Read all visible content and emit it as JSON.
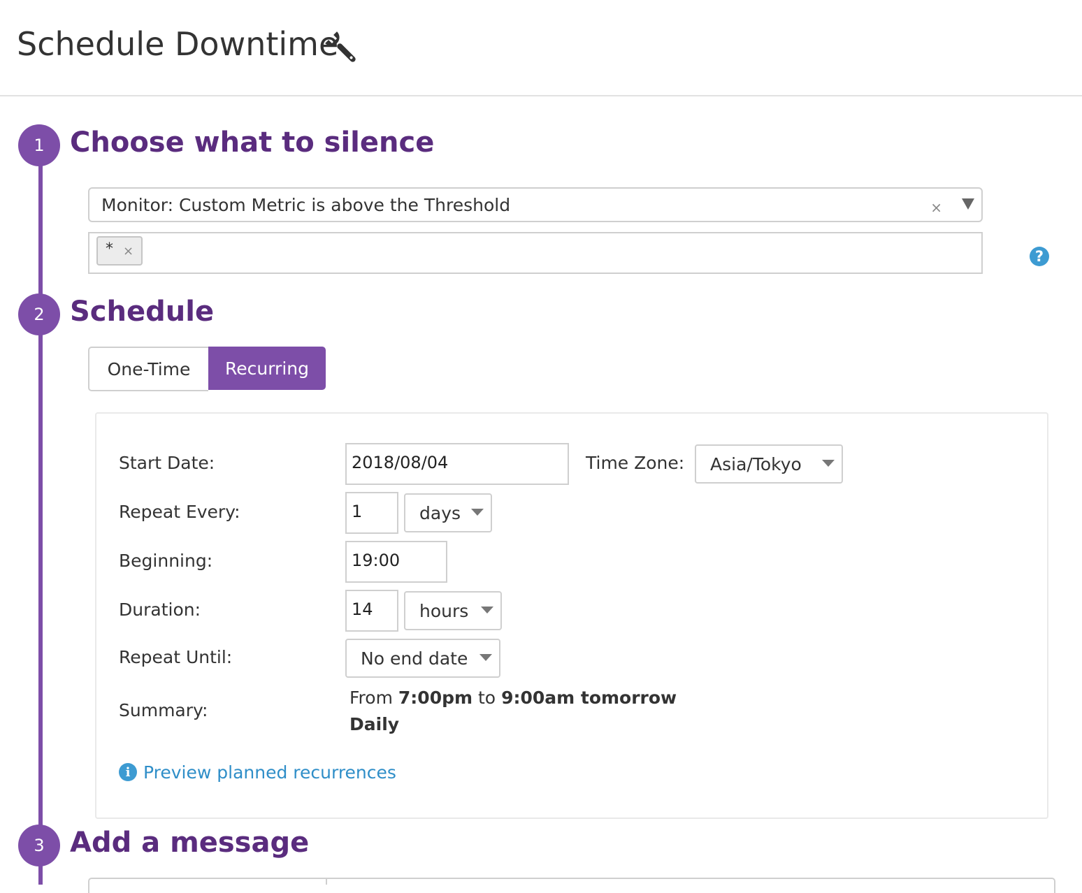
{
  "header": {
    "title": "Schedule Downtime",
    "icon": "wrench-icon"
  },
  "colors": {
    "accent": "#7d4ea8",
    "heading": "#5a2c7e",
    "link": "#2f8ec8",
    "help": "#3d9bd2"
  },
  "steps": [
    {
      "number": "1",
      "title": "Choose what to silence"
    },
    {
      "number": "2",
      "title": "Schedule"
    },
    {
      "number": "3",
      "title": "Add a message"
    }
  ],
  "silence": {
    "monitor_value": "Monitor: Custom Metric is above the Threshold",
    "clear_glyph": "×",
    "tag": "*",
    "tag_remove": "×",
    "help_glyph": "?"
  },
  "schedule": {
    "tabs": {
      "one_time": "One-Time",
      "recurring": "Recurring",
      "active": "recurring"
    },
    "form": {
      "start_date_label": "Start Date:",
      "start_date_value": "2018/08/04",
      "time_zone_label": "Time Zone:",
      "time_zone_value": "Asia/Tokyo",
      "repeat_every_label": "Repeat Every:",
      "repeat_every_value": "1",
      "repeat_every_unit": "days",
      "beginning_label": "Beginning:",
      "beginning_value": "19:00",
      "duration_label": "Duration:",
      "duration_value": "14",
      "duration_unit": "hours",
      "repeat_until_label": "Repeat Until:",
      "repeat_until_value": "No end date",
      "summary_label": "Summary:",
      "summary": {
        "from_word": "From",
        "start": "7:00pm",
        "to_word": "to",
        "end": "9:00am tomorrow",
        "frequency": "Daily"
      }
    },
    "preview_link": "Preview planned recurrences",
    "preview_icon_glyph": "i"
  }
}
